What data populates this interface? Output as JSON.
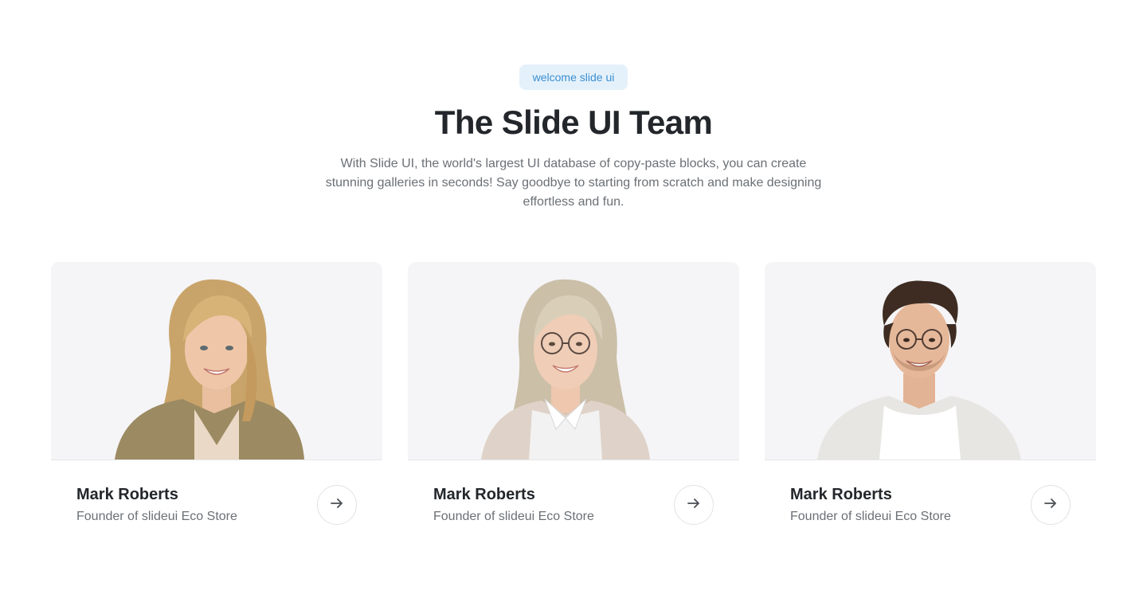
{
  "header": {
    "badge": "welcome slide ui",
    "title": "The Slide UI Team",
    "subtitle": "With Slide UI, the world's largest UI database of copy-paste blocks, you can create stunning galleries in seconds! Say goodbye to starting from scratch and make designing effortless and fun."
  },
  "team": [
    {
      "name": "Mark Roberts",
      "role": "Founder of slideui Eco Store",
      "action_icon": "arrow-right-icon"
    },
    {
      "name": "Mark Roberts",
      "role": "Founder of slideui Eco Store",
      "action_icon": "arrow-right-icon"
    },
    {
      "name": "Mark Roberts",
      "role": "Founder of slideui Eco Store",
      "action_icon": "arrow-right-icon"
    }
  ],
  "colors": {
    "badge_bg": "#e4f1fb",
    "badge_text": "#3c8fd0",
    "heading": "#23272b",
    "muted_text": "#6b7075",
    "card_bg": "#f5f5f7"
  }
}
